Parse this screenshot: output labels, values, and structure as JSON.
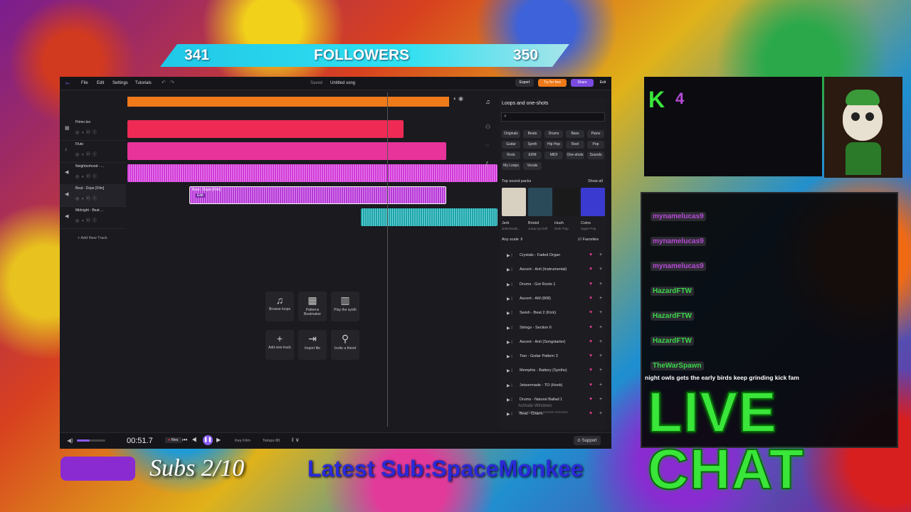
{
  "followers": {
    "current": "341",
    "label": "FOLLOWERS",
    "goal": "350"
  },
  "daw": {
    "menu": [
      "File",
      "Edit",
      "Settings",
      "Tutorials"
    ],
    "saved": "Saved",
    "song_title": "Untitled song",
    "export": "Export",
    "try_free": "Try for free",
    "share": "Share",
    "exit": "Exit",
    "tracks": [
      {
        "name": "Primo loo",
        "color": "#ee2a55"
      },
      {
        "name": "Flute",
        "color": "#e8339a"
      },
      {
        "name": "Neighborhood - ...",
        "color": "#d13ad6"
      },
      {
        "name": "Beat - Dope [Film]",
        "color": "#b33ad6"
      },
      {
        "name": "Midnight - Beat ...",
        "color": "#1fa3a8"
      }
    ],
    "clip_label": "Beat - Dope [Film]",
    "clip_edit": "Edit",
    "add_track": "Add New Track",
    "actions": [
      {
        "glyph": "♫",
        "label": "Browse loops"
      },
      {
        "glyph": "▦",
        "label": "Patterns Beatmaker"
      },
      {
        "glyph": "▥",
        "label": "Play the synth"
      },
      {
        "glyph": "+",
        "label": "Add new track"
      },
      {
        "glyph": "⇥",
        "label": "Import file"
      },
      {
        "glyph": "⚲",
        "label": "Invite a friend"
      }
    ],
    "time": "00:51.7",
    "rec": "Rec",
    "key": "Key F♯m",
    "tempo": "Tempo 80",
    "support": "Support",
    "progress": 0.45
  },
  "panel": {
    "title": "Loops and one-shots",
    "search_placeholder": "",
    "genres": [
      "Originals",
      "Beats",
      "Drums",
      "Bass",
      "Piano",
      "Guitar",
      "Synth",
      "Hip Hop",
      "Reel",
      "Pop",
      "Rock",
      "EDM",
      "MIDI",
      "One-shots",
      "Sounds",
      "My Loops",
      "Vocals"
    ],
    "top_packs_label": "Top sound packs",
    "show_all": "Show all",
    "packs": [
      {
        "name": "Jerk",
        "sub": "Jerk/Hoodt...",
        "color": "#d8d0c0"
      },
      {
        "name": "Bristol",
        "sub": "Jump Up Drill",
        "color": "#2a4a5a"
      },
      {
        "name": "Hush",
        "sub": "Dark Trap",
        "color": "#1a1a1a"
      },
      {
        "name": "Coins",
        "sub": "Hyper Pop",
        "color": "#3a3ad0"
      }
    ],
    "any_scale": "Any scale",
    "favorites": "Favorites",
    "loops": [
      "Crystals - Faded Organ",
      "Ascent - Anti (Instrumental)",
      "Drums - Got Roots 1",
      "Ascent - AM (808)",
      "Swish - Beat 2 (Kick)",
      "Strings - Section 6",
      "Ascent - Anti (Songstarter)",
      "Two - Guitar Pattern 3",
      "Memphis - Battery (Synths)",
      "Jetsonmade - TO (Hook)",
      "Drums - Natural Ballad 1",
      "Beat - Charm"
    ],
    "watermark": "Activate Windows",
    "watermark_sub": "Go to Settings to activate Windows."
  },
  "stream": {
    "k_label": "K",
    "k_count": "4",
    "chat": [
      {
        "user": "mynamelucas9",
        "color": "#b84ad8"
      },
      {
        "user": "mynamelucas9",
        "color": "#b84ad8"
      },
      {
        "user": "mynamelucas9",
        "color": "#b84ad8"
      },
      {
        "user": "HazardFTW",
        "color": "#3ad64a"
      },
      {
        "user": "HazardFTW",
        "color": "#3ad64a"
      },
      {
        "user": "HazardFTW",
        "color": "#3ad64a"
      },
      {
        "user": "TheWarSpawn",
        "color": "#3ad64a"
      }
    ],
    "last_message": "night owls gets the early birds keep grinding kick fam",
    "live_chat": "LIVE CHAT",
    "subs": "Subs 2/10",
    "latest_sub": "Latest Sub:SpaceMonkee"
  }
}
